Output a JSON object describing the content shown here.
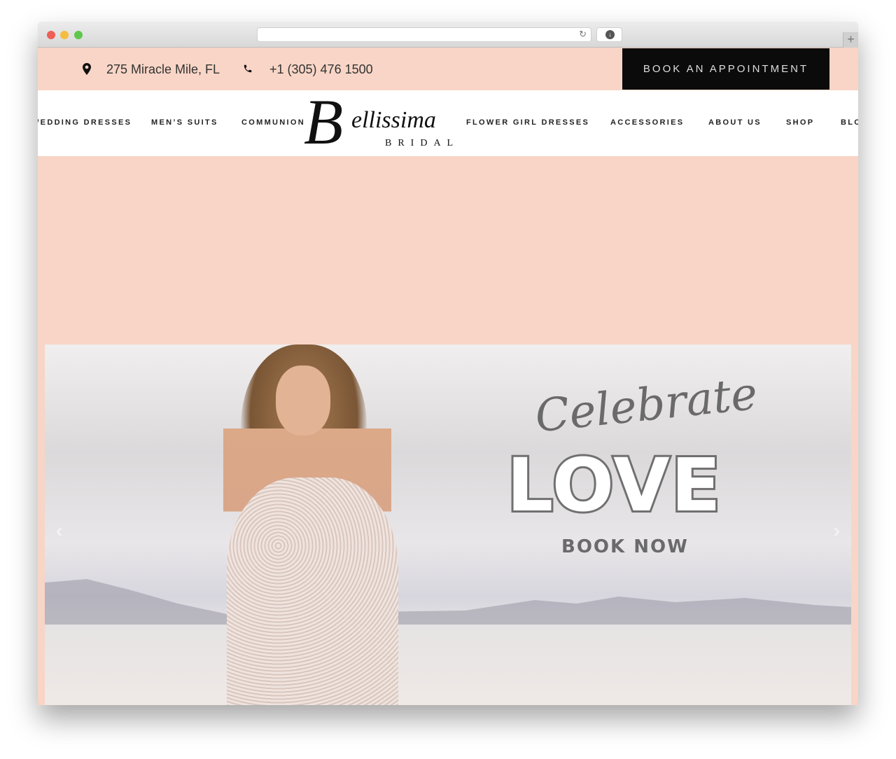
{
  "browser": {
    "url": "",
    "reload_icon": "reload-icon",
    "download_icon": "download-icon",
    "new_tab_icon": "plus-icon"
  },
  "topbar": {
    "address": "275 Miracle Mile, FL",
    "phone": "+1 (305) 476 1500",
    "book_label": "BOOK AN APPOINTMENT",
    "accent_color": "#f8d5c6"
  },
  "nav": {
    "items": [
      "WEDDING DRESSES",
      "MEN’S SUITS",
      "COMMUNION",
      "FLOWER GIRL DRESSES",
      "ACCESSORIES",
      "ABOUT US",
      "SHOP",
      "BLOG"
    ]
  },
  "logo": {
    "initial": "B",
    "name": "ellissima",
    "sub": "BRIDAL"
  },
  "hero": {
    "script": "Celebrate",
    "headline": "LOVE",
    "cta": "BOOK NOW",
    "prev": "‹",
    "next": "›"
  }
}
